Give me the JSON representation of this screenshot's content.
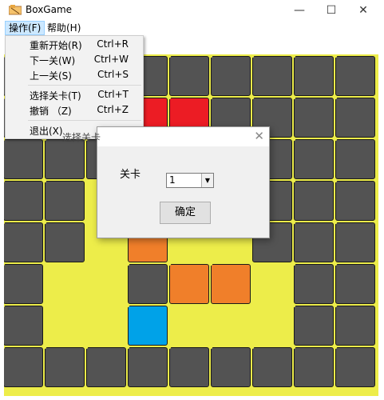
{
  "window": {
    "title": "BoxGame",
    "minimize": "—",
    "maximize": "☐",
    "close": "✕"
  },
  "menubar": {
    "items": [
      {
        "label": "操作(F)"
      },
      {
        "label": "帮助(H)"
      }
    ]
  },
  "operation_menu": {
    "items": [
      {
        "label": "重新开始(R)",
        "shortcut": "Ctrl+R"
      },
      {
        "label": "下一关(W)",
        "shortcut": "Ctrl+W"
      },
      {
        "label": "上一关(S)",
        "shortcut": "Ctrl+S"
      },
      {
        "label": "选择关卡(T)",
        "shortcut": "Ctrl+T"
      },
      {
        "label": "撤销 （Z)",
        "shortcut": "Ctrl+Z"
      },
      {
        "label": "退出(X)",
        "shortcut": ""
      }
    ]
  },
  "level_dialog": {
    "title": "选择关卡",
    "close": "✕",
    "label": "关卡",
    "selected_level": "1",
    "ok_label": "确定"
  },
  "board": {
    "legend": {
      "W": "wall",
      "F": "floor",
      "B": "box",
      "P": "player",
      "R": "target-red"
    },
    "rows": [
      "WWWWWWWWW",
      "WWWRRWWWW",
      "WWWFFFWWW",
      "WWFFFFWWW",
      "WWFBFFWWW",
      "WFFWBBFWW",
      "WFFPFFFWW",
      "WWWWWWWWW"
    ],
    "colors": {
      "floor": "#eded4a",
      "wall": "#535353",
      "box": "#f07f2a",
      "player": "#00a2e8",
      "target": "#ec1c24"
    }
  }
}
